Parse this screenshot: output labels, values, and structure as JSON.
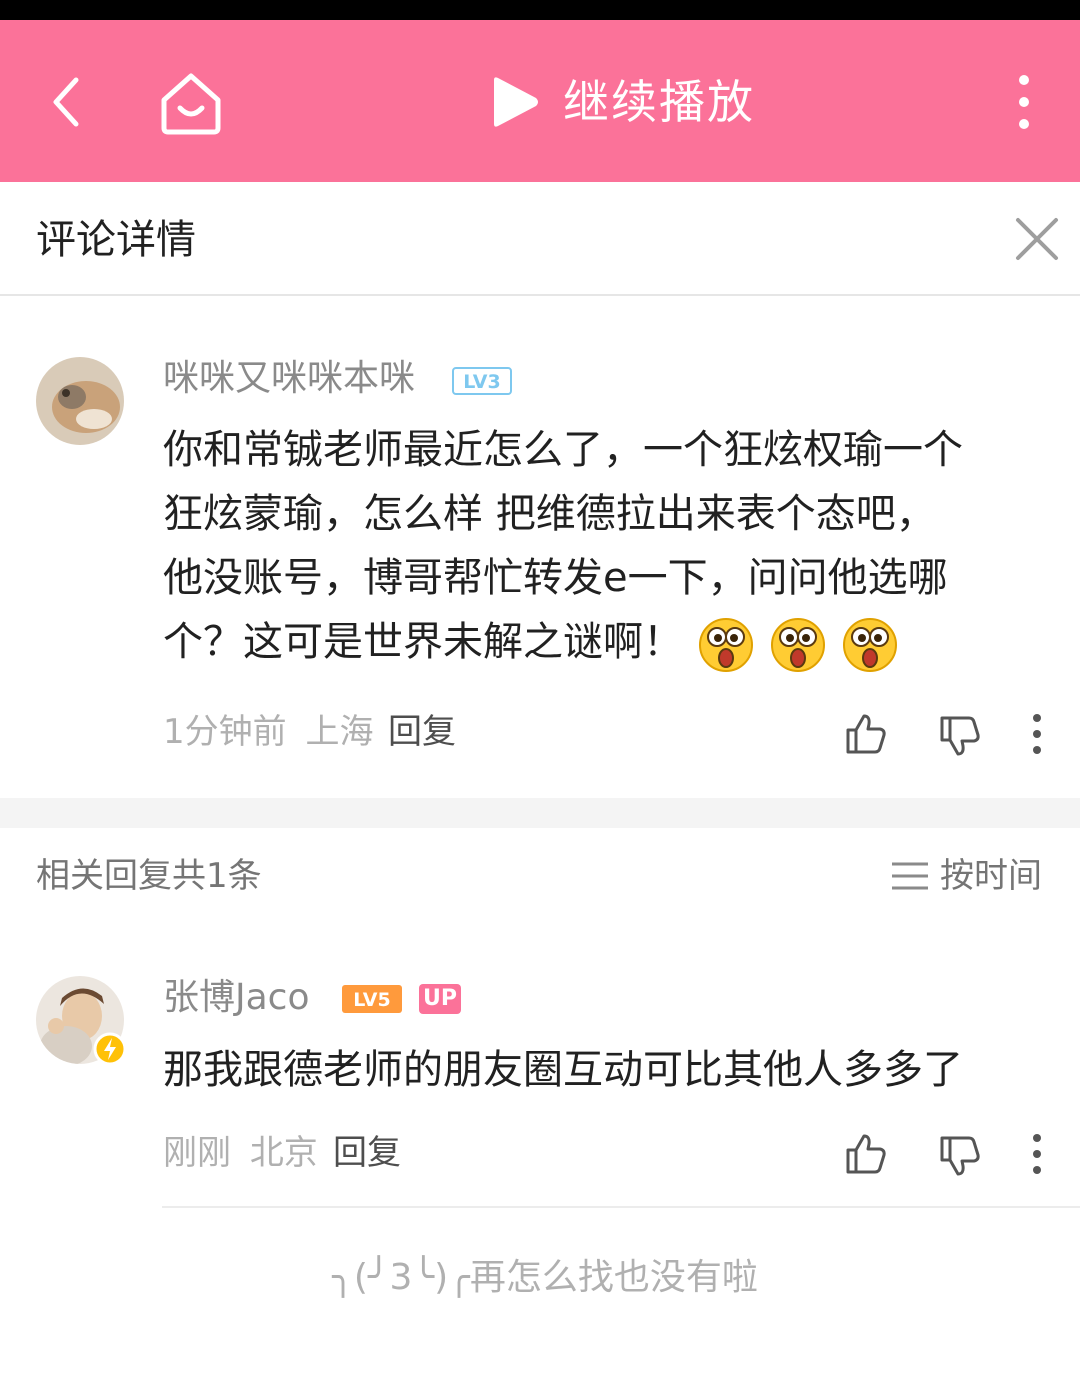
{
  "top_bar": {
    "play_label": "继续播放"
  },
  "detail_header": {
    "title": "评论详情"
  },
  "main_comment": {
    "username": "咪咪又咪咪本咪",
    "level": "LV3",
    "lines": [
      "你和常铖老师最近怎么了，一个狂炫权瑜一个",
      "狂炫蒙瑜，怎么样 把维德拉出来表个态吧，",
      "他没账号，博哥帮忙转发e一下，问问他选哪",
      "个？这可是世界未解之谜啊！"
    ],
    "emoji_count": 3,
    "time": "1分钟前",
    "location": "上海",
    "reply_label": "回复"
  },
  "related": {
    "title": "相关回复共1条",
    "sort_label": "按时间"
  },
  "reply_comment": {
    "username": "张博Jaco",
    "level": "LV5",
    "up_badge": "UP",
    "text": "那我跟德老师的朋友圈互动可比其他人多多了",
    "time": "刚刚",
    "location": "北京",
    "reply_label": "回复"
  },
  "end_message": "╮(╯3╰)╭再怎么找也没有啦",
  "colors": {
    "brand_pink": "#fb7299",
    "lv3_blue": "#7ec8ef",
    "lv5_orange": "#ff9a3c",
    "verified_yellow": "#ffc107"
  }
}
